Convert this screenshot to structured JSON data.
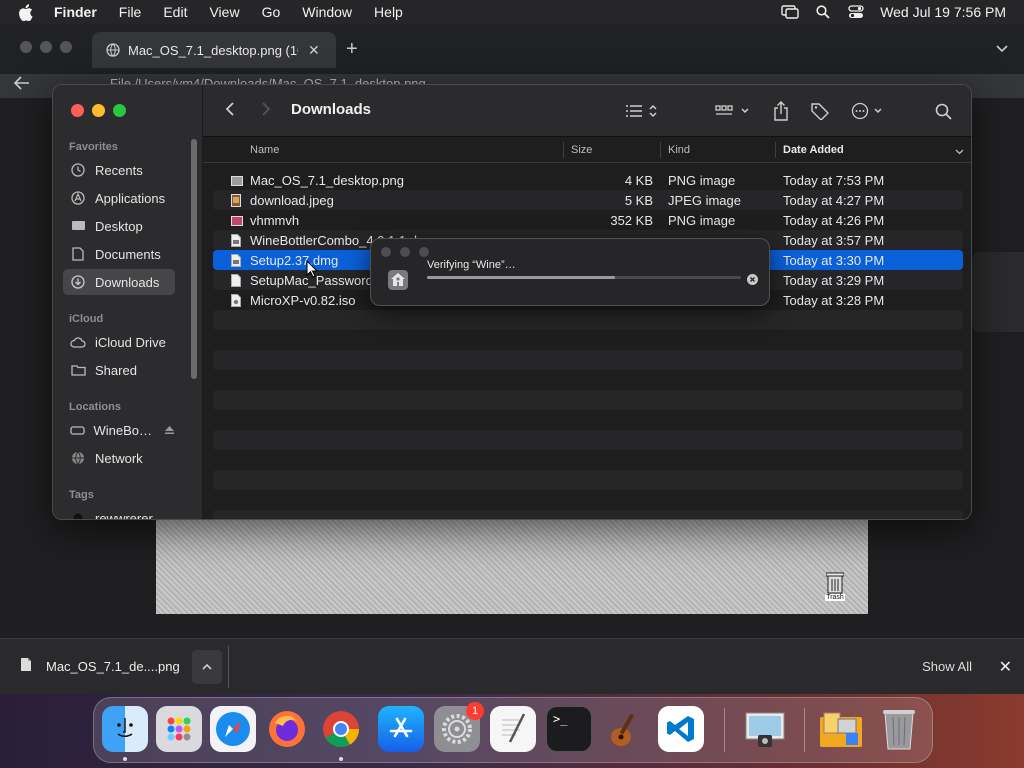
{
  "menubar": {
    "app": "Finder",
    "items": [
      "File",
      "Edit",
      "View",
      "Go",
      "Window",
      "Help"
    ],
    "clock": "Wed Jul 19  7:56 PM"
  },
  "browser": {
    "tab_title": "Mac_OS_7.1_desktop.png (10…",
    "address": "File   /Users/vm4/Downloads/Mac_OS_7.1_desktop.png",
    "trash_label": "Trash"
  },
  "download_bar": {
    "file_name": "Mac_OS_7.1_de....png",
    "show_all": "Show All"
  },
  "finder": {
    "title": "Downloads",
    "sidebar": {
      "favorites_label": "Favorites",
      "favorites": [
        {
          "label": "Recents",
          "icon": "clock-icon"
        },
        {
          "label": "Applications",
          "icon": "applications-icon"
        },
        {
          "label": "Desktop",
          "icon": "desktop-icon"
        },
        {
          "label": "Documents",
          "icon": "document-icon"
        },
        {
          "label": "Downloads",
          "icon": "download-icon"
        }
      ],
      "icloud_label": "iCloud",
      "icloud": [
        {
          "label": "iCloud Drive",
          "icon": "cloud-icon"
        },
        {
          "label": "Shared",
          "icon": "shared-folder-icon"
        }
      ],
      "locations_label": "Locations",
      "locations": [
        {
          "label": "WineBo…",
          "icon": "disk-icon"
        },
        {
          "label": "Network",
          "icon": "network-icon"
        }
      ],
      "tags_label": "Tags",
      "tags": [
        {
          "label": "rewwrerer"
        }
      ]
    },
    "columns": {
      "name": "Name",
      "size": "Size",
      "kind": "Kind",
      "date": "Date Added"
    },
    "files": [
      {
        "name": "Mac_OS_7.1_desktop.png",
        "size": "4 KB",
        "kind": "PNG image",
        "date": "Today at 7:53 PM"
      },
      {
        "name": "download.jpeg",
        "size": "5 KB",
        "kind": "JPEG image",
        "date": "Today at 4:27 PM"
      },
      {
        "name": "vhmmvh",
        "size": "352 KB",
        "kind": "PNG image",
        "date": "Today at 4:26 PM"
      },
      {
        "name": "WineBottlerCombo_4.0.1.1.dmg",
        "size": "",
        "kind": "",
        "date": "Today at 3:57 PM"
      },
      {
        "name": "Setup2.37.dmg",
        "size": "",
        "kind": "",
        "date": "Today at 3:30 PM"
      },
      {
        "name": "SetupMac_Password",
        "size": "",
        "kind": "",
        "date": "Today at 3:29 PM"
      },
      {
        "name": "MicroXP-v0.82.iso",
        "size": "",
        "kind": "",
        "date": "Today at 3:28 PM"
      }
    ]
  },
  "verify_dialog": {
    "text": "Verifying “Wine”…",
    "progress": 0.6
  },
  "dock": {
    "apps": [
      "Finder",
      "Launchpad",
      "Safari",
      "Firefox",
      "Chrome",
      "App Store",
      "System Settings",
      "TextEdit",
      "Terminal",
      "Instruments",
      "Visual Studio Code",
      "Preview",
      "Downloads",
      "Trash"
    ],
    "settings_badge": "1"
  }
}
